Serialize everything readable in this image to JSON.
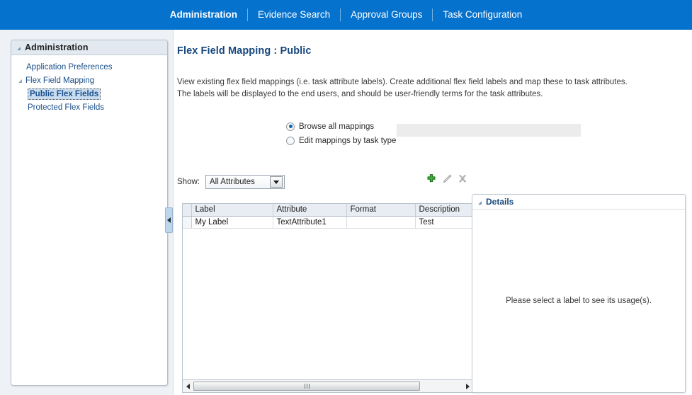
{
  "topnav": {
    "items": [
      {
        "label": "Administration",
        "active": true
      },
      {
        "label": "Evidence Search",
        "active": false
      },
      {
        "label": "Approval Groups",
        "active": false
      },
      {
        "label": "Task Configuration",
        "active": false
      }
    ]
  },
  "sidebar": {
    "title": "Administration",
    "collapse_icon": "triangle-collapse-icon",
    "items": [
      {
        "label": "Application Preferences",
        "level": 1,
        "has_toggle": false,
        "selected": false
      },
      {
        "label": "Flex Field Mapping",
        "level": 1,
        "has_toggle": true,
        "selected": false
      },
      {
        "label": "Public Flex Fields",
        "level": 2,
        "has_toggle": false,
        "selected": true
      },
      {
        "label": "Protected Flex Fields",
        "level": 2,
        "has_toggle": false,
        "selected": false
      }
    ]
  },
  "splitter": {
    "icon": "collapse-left-arrow-icon"
  },
  "main": {
    "page_title": "Flex Field Mapping : Public",
    "intro_line1": "View existing flex field mappings (i.e. task attribute labels). Create additional flex field labels and map these to task attributes.",
    "intro_line2": "The labels will be displayed to the end users, and should be user-friendly terms for the task attributes.",
    "mode_options": [
      {
        "label": "Browse all mappings",
        "checked": true
      },
      {
        "label": "Edit mappings by task type",
        "checked": false
      }
    ],
    "task_type_field": {
      "value": "",
      "placeholder": "",
      "disabled": true
    },
    "show": {
      "label": "Show:",
      "selected": "All Attributes",
      "options": [
        "All Attributes"
      ]
    },
    "toolbar": [
      {
        "name": "add-icon",
        "title": "Add",
        "enabled": true
      },
      {
        "name": "edit-pencil-icon",
        "title": "Edit",
        "enabled": false
      },
      {
        "name": "delete-x-icon",
        "title": "Delete",
        "enabled": false
      }
    ],
    "table": {
      "columns": [
        "Label",
        "Attribute",
        "Format",
        "Description"
      ],
      "rows": [
        {
          "label": "My Label",
          "attribute": "TextAttribute1",
          "format": "",
          "description": "Test"
        }
      ]
    },
    "scrollbar": {
      "left_icon": "scroll-left-arrow-icon",
      "right_icon": "scroll-right-arrow-icon"
    },
    "details": {
      "title": "Details",
      "collapse_icon": "triangle-collapse-icon",
      "empty_message": "Please select a label to see its usage(s)."
    }
  },
  "colors": {
    "nav_blue": "#0572ce",
    "page_bg": "#eef1f5",
    "title_blue": "#16477d",
    "link_blue": "#1b4f8a",
    "selection_blue": "#c8dcf0",
    "add_green": "#3aa832"
  }
}
